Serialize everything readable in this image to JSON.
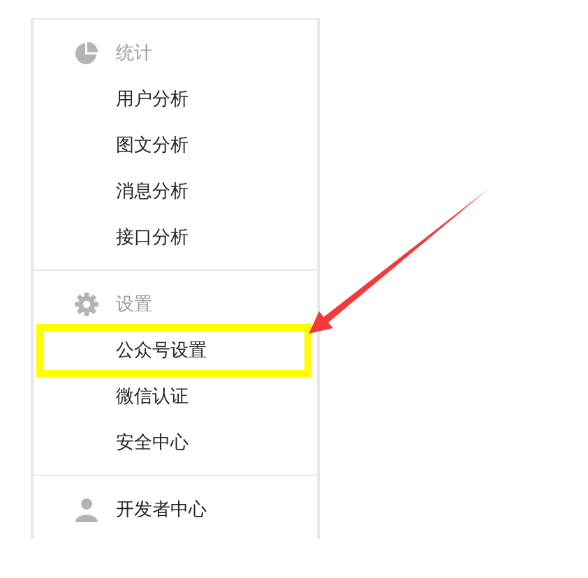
{
  "sections": [
    {
      "title": "统计",
      "items": [
        {
          "label": "用户分析",
          "highlighted": false
        },
        {
          "label": "图文分析",
          "highlighted": false
        },
        {
          "label": "消息分析",
          "highlighted": false
        },
        {
          "label": "接口分析",
          "highlighted": false
        }
      ]
    },
    {
      "title": "设置",
      "items": [
        {
          "label": "公众号设置",
          "highlighted": true
        },
        {
          "label": "微信认证",
          "highlighted": false
        },
        {
          "label": "安全中心",
          "highlighted": false
        }
      ]
    },
    {
      "title": "开发者中心"
    }
  ]
}
